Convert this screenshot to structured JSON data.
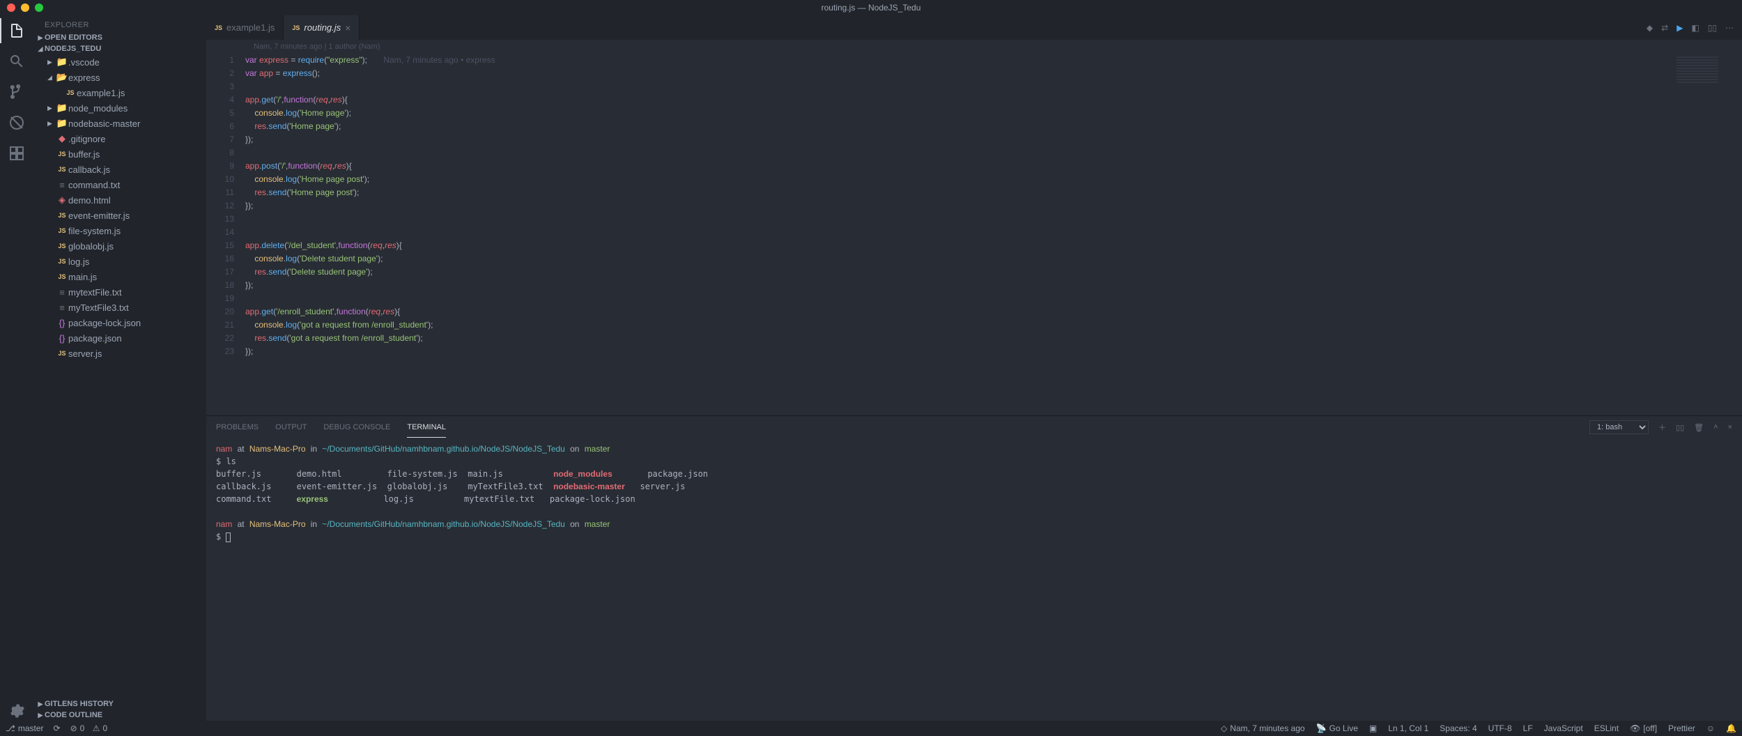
{
  "title": "routing.js — NodeJS_Tedu",
  "sidebar_title": "EXPLORER",
  "sections": {
    "open_editors": "OPEN EDITORS",
    "project": "NODEJS_TEDU",
    "gitlens": "GITLENS HISTORY",
    "outline": "CODE OUTLINE"
  },
  "tree": {
    "vscode": ".vscode",
    "express": "express",
    "example1": "example1.js",
    "node_modules": "node_modules",
    "nodebasic": "nodebasic-master",
    "gitignore": ".gitignore",
    "buffer": "buffer.js",
    "callback": "callback.js",
    "command": "command.txt",
    "demo": "demo.html",
    "eventemitter": "event-emitter.js",
    "filesystem": "file-system.js",
    "globalobj": "globalobj.js",
    "log": "log.js",
    "main": "main.js",
    "mytextfile": "mytextFile.txt",
    "mytextfile3": "myTextFile3.txt",
    "pkglock": "package-lock.json",
    "pkg": "package.json",
    "server": "server.js"
  },
  "tabs": {
    "t1": "example1.js",
    "t2": "routing.js"
  },
  "blame": "Nam, 7 minutes ago | 1 author (Nam)",
  "inline_blame": "Nam, 7 minutes ago • express",
  "code_lines": [
    {
      "n": 1,
      "html": "<span class='tk-kw'>var</span> <span class='tk-var'>express</span> <span class='tk-pun'>=</span> <span class='tk-fn'>require</span><span class='tk-pun'>(</span><span class='tk-str'>\"express\"</span><span class='tk-pun'>);</span>       <span class='tk-blame'>Nam, 7 minutes ago • express</span>"
    },
    {
      "n": 2,
      "html": "<span class='tk-kw'>var</span> <span class='tk-var'>app</span> <span class='tk-pun'>=</span> <span class='tk-fn'>express</span><span class='tk-pun'>();</span>"
    },
    {
      "n": 3,
      "html": ""
    },
    {
      "n": 4,
      "html": "<span class='tk-var'>app</span><span class='tk-pun'>.</span><span class='tk-fn'>get</span><span class='tk-pun'>(</span><span class='tk-str'>'/'</span><span class='tk-pun'>,</span><span class='tk-kw'>function</span><span class='tk-pun'>(</span><span class='tk-var tk-italic'>req</span><span class='tk-pun'>,</span><span class='tk-var tk-italic'>res</span><span class='tk-pun'>){</span>"
    },
    {
      "n": 5,
      "html": "    <span class='tk-prop'>console</span><span class='tk-pun'>.</span><span class='tk-fn'>log</span><span class='tk-pun'>(</span><span class='tk-str'>'Home page'</span><span class='tk-pun'>);</span>"
    },
    {
      "n": 6,
      "html": "    <span class='tk-var'>res</span><span class='tk-pun'>.</span><span class='tk-fn'>send</span><span class='tk-pun'>(</span><span class='tk-str'>'Home page'</span><span class='tk-pun'>);</span>"
    },
    {
      "n": 7,
      "html": "<span class='tk-pun'>});</span>"
    },
    {
      "n": 8,
      "html": ""
    },
    {
      "n": 9,
      "html": "<span class='tk-var'>app</span><span class='tk-pun'>.</span><span class='tk-fn'>post</span><span class='tk-pun'>(</span><span class='tk-str'>'/'</span><span class='tk-pun'>,</span><span class='tk-kw'>function</span><span class='tk-pun'>(</span><span class='tk-var tk-italic'>req</span><span class='tk-pun'>,</span><span class='tk-var tk-italic'>res</span><span class='tk-pun'>){</span>"
    },
    {
      "n": 10,
      "html": "    <span class='tk-prop'>console</span><span class='tk-pun'>.</span><span class='tk-fn'>log</span><span class='tk-pun'>(</span><span class='tk-str'>'Home page post'</span><span class='tk-pun'>);</span>"
    },
    {
      "n": 11,
      "html": "    <span class='tk-var'>res</span><span class='tk-pun'>.</span><span class='tk-fn'>send</span><span class='tk-pun'>(</span><span class='tk-str'>'Home page post'</span><span class='tk-pun'>);</span>"
    },
    {
      "n": 12,
      "html": "<span class='tk-pun'>});</span>"
    },
    {
      "n": 13,
      "html": ""
    },
    {
      "n": 14,
      "html": ""
    },
    {
      "n": 15,
      "html": "<span class='tk-var'>app</span><span class='tk-pun'>.</span><span class='tk-fn'>delete</span><span class='tk-pun'>(</span><span class='tk-str'>'/del_student'</span><span class='tk-pun'>,</span><span class='tk-kw'>function</span><span class='tk-pun'>(</span><span class='tk-var tk-italic'>req</span><span class='tk-pun'>,</span><span class='tk-var tk-italic'>res</span><span class='tk-pun'>){</span>"
    },
    {
      "n": 16,
      "html": "    <span class='tk-prop'>console</span><span class='tk-pun'>.</span><span class='tk-fn'>log</span><span class='tk-pun'>(</span><span class='tk-str'>'Delete student page'</span><span class='tk-pun'>);</span>"
    },
    {
      "n": 17,
      "html": "    <span class='tk-var'>res</span><span class='tk-pun'>.</span><span class='tk-fn'>send</span><span class='tk-pun'>(</span><span class='tk-str'>'Delete student page'</span><span class='tk-pun'>);</span>"
    },
    {
      "n": 18,
      "html": "<span class='tk-pun'>});</span>"
    },
    {
      "n": 19,
      "html": ""
    },
    {
      "n": 20,
      "html": "<span class='tk-var'>app</span><span class='tk-pun'>.</span><span class='tk-fn'>get</span><span class='tk-pun'>(</span><span class='tk-str'>'/enroll_student'</span><span class='tk-pun'>,</span><span class='tk-kw'>function</span><span class='tk-pun'>(</span><span class='tk-var tk-italic'>req</span><span class='tk-pun'>,</span><span class='tk-var tk-italic'>res</span><span class='tk-pun'>){</span>"
    },
    {
      "n": 21,
      "html": "    <span class='tk-prop'>console</span><span class='tk-pun'>.</span><span class='tk-fn'>log</span><span class='tk-pun'>(</span><span class='tk-str'>'got a request from /enroll_student'</span><span class='tk-pun'>);</span>"
    },
    {
      "n": 22,
      "html": "    <span class='tk-var'>res</span><span class='tk-pun'>.</span><span class='tk-fn'>send</span><span class='tk-pun'>(</span><span class='tk-str'>'got a request from /enroll_student'</span><span class='tk-pun'>);</span>"
    },
    {
      "n": 23,
      "html": "<span class='tk-pun'>});</span>"
    }
  ],
  "panel_tabs": {
    "problems": "PROBLEMS",
    "output": "OUTPUT",
    "debug": "DEBUG CONSOLE",
    "terminal": "TERMINAL"
  },
  "terminal_dropdown": "1: bash",
  "terminal": {
    "user": "nam",
    "at": "at",
    "host": "Nams-Mac-Pro",
    "in": "in",
    "path": "~/Documents/GitHub/namhbnam.github.io/NodeJS/NodeJS_Tedu",
    "on": "on",
    "branch": "master",
    "cmd_ls": "$ ls",
    "ls_col1": "buffer.js\ncallback.js\ncommand.txt",
    "ls_col2": "demo.html\nevent-emitter.js",
    "ls_col2b": "express",
    "ls_col3": "file-system.js\nglobalobj.js\nlog.js",
    "ls_col4": "main.js\nmyTextFile3.txt\nmytextFile.txt",
    "ls_col5a": "node_modules",
    "ls_col5b": "nodebasic-master",
    "ls_col5c": "package-lock.json",
    "ls_col6": "package.json\nserver.js",
    "prompt2": "$ "
  },
  "statusbar": {
    "branch": "master",
    "errors": "0",
    "warnings": "0",
    "blame": "Nam, 7 minutes ago",
    "golive": "Go Live",
    "lncol": "Ln 1, Col 1",
    "spaces": "Spaces: 4",
    "encoding": "UTF-8",
    "eol": "LF",
    "lang": "JavaScript",
    "eslint": "ESLint",
    "off": "[off]",
    "prettier": "Prettier"
  }
}
